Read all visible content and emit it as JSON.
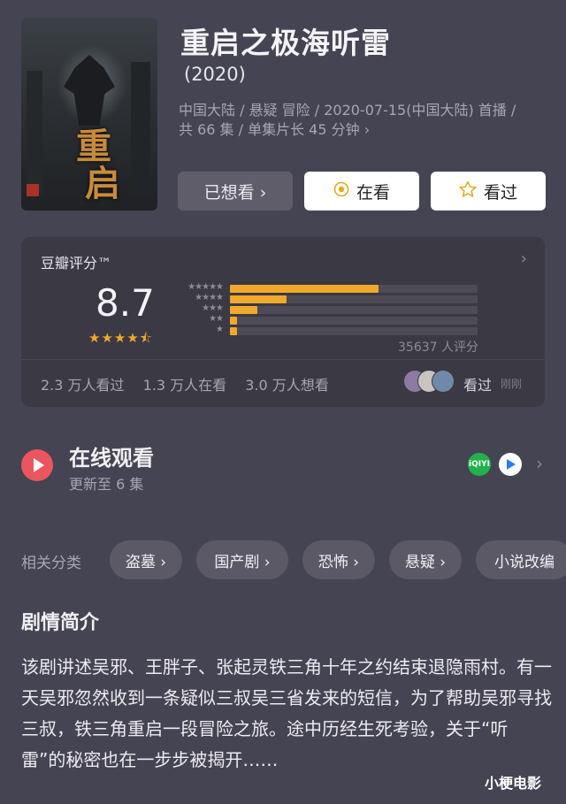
{
  "header": {
    "title": "重启之极海听雷",
    "year": "(2020)",
    "meta_line1": "中国大陆 / 悬疑 冒险 / 2020-07-15(中国大陆) 首播 /",
    "meta_line2": "共 66 集 / 单集片长 45 分钟 ›"
  },
  "poster": {
    "chars": [
      "重",
      "启"
    ]
  },
  "actions": {
    "want": "已想看 ›",
    "watching": "在看",
    "watched": "看过",
    "watching_icon": "target-icon",
    "watched_icon": "star-icon"
  },
  "rating": {
    "label": "豆瓣评分™",
    "score": "8.7",
    "stars": 4.5,
    "stars_text": "★★★★⯪",
    "breakdown": [
      {
        "stars": "★★★★★",
        "fraction": 0.6
      },
      {
        "stars": "★★★★",
        "fraction": 0.23
      },
      {
        "stars": "★★★",
        "fraction": 0.11
      },
      {
        "stars": "★★",
        "fraction": 0.03
      },
      {
        "stars": "★",
        "fraction": 0.03
      }
    ],
    "count": "35637 人评分",
    "watched": "2.3 万人看过",
    "watching": "1.3 万人在看",
    "want": "3.0 万人想看",
    "friends_action": "看过",
    "friends_time": "刚刚",
    "colors": {
      "accent": "#f0a92b"
    }
  },
  "online": {
    "title": "在线观看",
    "subtitle": "更新至 6 集",
    "providers": [
      "iqiyi",
      "youku"
    ],
    "iqiyi_text": "iQIYI"
  },
  "categories": {
    "label": "相关分类",
    "tags": [
      "盗墓 ›",
      "国产剧 ›",
      "恐怖 ›",
      "悬疑 ›",
      "小说改编"
    ]
  },
  "summary": {
    "title": "剧情简介",
    "text": "该剧讲述吴邪、王胖子、张起灵铁三角十年之约结束退隐雨村。有一天吴邪忽然收到一条疑似三叔吴三省发来的短信，为了帮助吴邪寻找三叔，铁三角重启一段冒险之旅。途中历经生死考验，关于“听雷”的秘密也在一步步被揭开……"
  },
  "watermark": "小梗电影"
}
